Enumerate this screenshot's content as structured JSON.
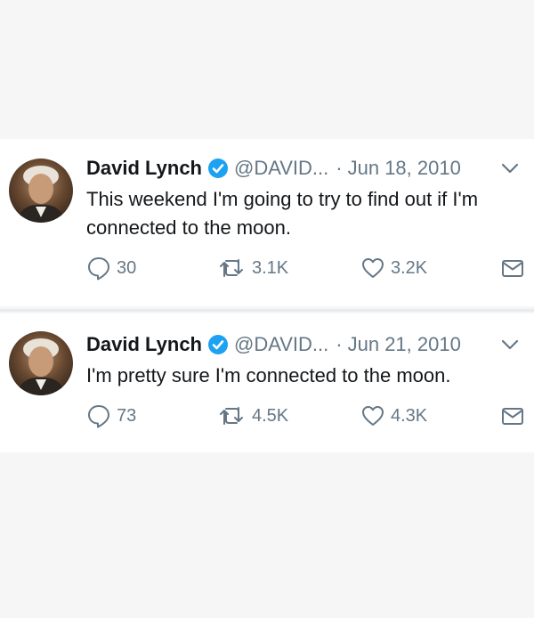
{
  "tweets": [
    {
      "author_name": "David Lynch",
      "handle": "@DAVID...",
      "separator": "·",
      "date": "Jun 18, 2010",
      "text": "This weekend I'm going to try to find out if I'm connected to the moon.",
      "replies": "30",
      "retweets": "3.1K",
      "likes": "3.2K"
    },
    {
      "author_name": "David Lynch",
      "handle": "@DAVID...",
      "separator": "·",
      "date": "Jun 21, 2010",
      "text": "I'm pretty sure I'm connected to the moon.",
      "replies": "73",
      "retweets": "4.5K",
      "likes": "4.3K"
    }
  ],
  "icons": {
    "verified": "verified-badge-icon",
    "chevron": "chevron-down-icon",
    "reply": "reply-icon",
    "retweet": "retweet-icon",
    "like": "heart-icon",
    "dm": "envelope-icon"
  },
  "colors": {
    "background": "#f6f6f7",
    "card": "#ffffff",
    "text": "#14171a",
    "muted": "#657786",
    "verified": "#1da1f2"
  }
}
